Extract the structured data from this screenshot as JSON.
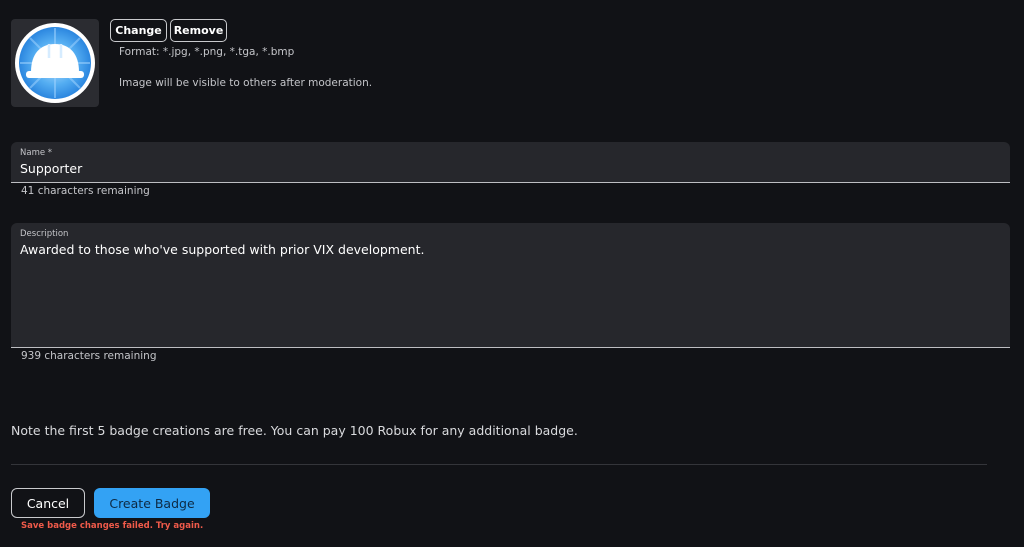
{
  "image": {
    "icon": "hard-hat-icon",
    "actions": {
      "change_label": "Change",
      "remove_label": "Remove"
    },
    "format_hint": "Format: *.jpg, *.png, *.tga, *.bmp",
    "moderation_hint": "Image will be visible to others after moderation."
  },
  "name_field": {
    "label": "Name *",
    "value": "Supporter",
    "remaining": "41 characters remaining"
  },
  "description_field": {
    "label": "Description",
    "value": "Awarded to those who've supported with prior VIX development.",
    "remaining": "939 characters remaining"
  },
  "note": "Note the first 5 badge creations are free. You can pay 100 Robux for any additional badge.",
  "actions": {
    "cancel_label": "Cancel",
    "create_label": "Create Badge"
  },
  "error_message": "Save badge changes failed. Try again.",
  "colors": {
    "background": "#111216",
    "field_background": "#26272c",
    "primary": "#33a2f4",
    "error": "#ef5a4a",
    "badge_blue": "#2f8fe6"
  }
}
